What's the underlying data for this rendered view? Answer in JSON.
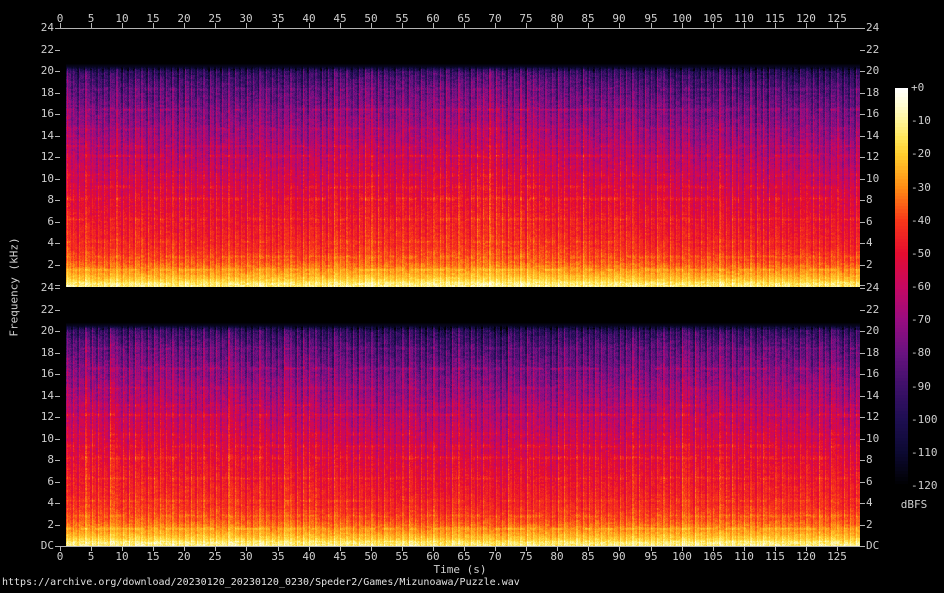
{
  "axes": {
    "x_label": "Time (s)",
    "y_label": "Frequency (kHz)",
    "time_tick_labels": [
      "0",
      "5",
      "10",
      "15",
      "20",
      "25",
      "30",
      "35",
      "40",
      "45",
      "50",
      "55",
      "60",
      "65",
      "70",
      "75",
      "80",
      "85",
      "90",
      "95",
      "100",
      "105",
      "110",
      "115",
      "120",
      "125"
    ],
    "freq_tick_labels": [
      "24",
      "22",
      "20",
      "18",
      "16",
      "14",
      "12",
      "10",
      "8",
      "6",
      "4",
      "2"
    ],
    "dc_label": "DC"
  },
  "colorbar": {
    "label": "dBFS",
    "tick_labels": [
      "+0",
      "-10",
      "-20",
      "-30",
      "-40",
      "-50",
      "-60",
      "-70",
      "-80",
      "-90",
      "-100",
      "-110",
      "-120"
    ]
  },
  "footer": {
    "url": "https://archive.org/download/20230120_20230120_0230/Speder2/Games/Mizunoawa/Puzzle.wav"
  },
  "chart_data": {
    "type": "heatmap",
    "subtype": "stereo-audio-spectrogram",
    "channels": 2,
    "title": "",
    "xlabel": "Time (s)",
    "ylabel": "Frequency (kHz)",
    "x_range_s": [
      0,
      128.7
    ],
    "x_tick_step_s": 5,
    "y_range_khz_per_channel": [
      0,
      24
    ],
    "y_tick_step_khz": 2,
    "y_bottom_label": "DC",
    "colorbar_label": "dBFS",
    "colorbar_range_db": [
      0,
      -120
    ],
    "colorbar_tick_step_db": 10,
    "grid": false,
    "legend_position": "right-colorbar",
    "palette_stops_db_hex": [
      [
        0,
        "#ffffff"
      ],
      [
        -5,
        "#fffcd2"
      ],
      [
        -10,
        "#fff496"
      ],
      [
        -15,
        "#ffe65a"
      ],
      [
        -20,
        "#ffcd2d"
      ],
      [
        -30,
        "#ff8c14"
      ],
      [
        -40,
        "#f83719"
      ],
      [
        -50,
        "#e40c30"
      ],
      [
        -60,
        "#c60862"
      ],
      [
        -70,
        "#980c80"
      ],
      [
        -80,
        "#691280"
      ],
      [
        -90,
        "#3e106a"
      ],
      [
        -100,
        "#1e0e52"
      ],
      [
        -110,
        "#0c0932"
      ],
      [
        -120,
        "#000000"
      ]
    ],
    "audio_start_s": 1.0,
    "bandwidth_cutoff_khz": 20.4,
    "beat_period_s": 1.0,
    "level_profile_khz_dbfs": [
      [
        0,
        -13
      ],
      [
        0.4,
        -16
      ],
      [
        0.8,
        -22
      ],
      [
        1.5,
        -30
      ],
      [
        2.5,
        -38
      ],
      [
        4,
        -44
      ],
      [
        6,
        -48
      ],
      [
        8,
        -52
      ],
      [
        10,
        -57
      ],
      [
        12,
        -62
      ],
      [
        14,
        -68
      ],
      [
        16,
        -75
      ],
      [
        17.5,
        -81
      ],
      [
        19,
        -88
      ],
      [
        20,
        -96
      ],
      [
        20.4,
        -112
      ],
      [
        20.9,
        -122
      ],
      [
        24,
        -124
      ]
    ],
    "harmonic_lines_khz_gain_halfwidth": [
      [
        1.6,
        6,
        0.18
      ],
      [
        2.8,
        4,
        0.18
      ],
      [
        4.2,
        4,
        0.18
      ],
      [
        6.3,
        5,
        0.2
      ],
      [
        8.2,
        7,
        0.25
      ],
      [
        9.3,
        6,
        0.25
      ],
      [
        10.4,
        5,
        0.2
      ],
      [
        12.2,
        8,
        0.22
      ],
      [
        13.1,
        6,
        0.18
      ],
      [
        14.7,
        5,
        0.18
      ],
      [
        16.5,
        9,
        0.2
      ],
      [
        18.4,
        6,
        0.18
      ]
    ]
  }
}
